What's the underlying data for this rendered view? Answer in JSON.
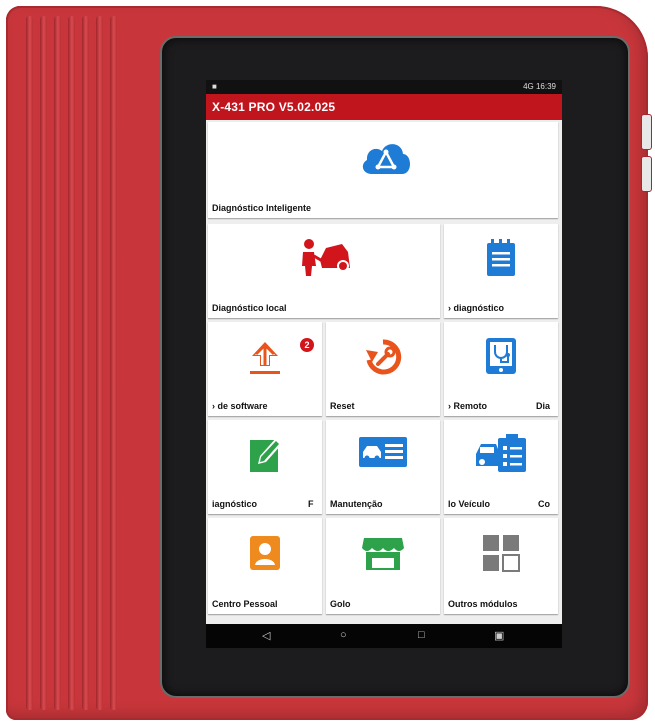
{
  "status_bar": {
    "left_icon": "notification-icon",
    "right_text": "4G 16:39"
  },
  "app_bar": {
    "title": "X-431 PRO V5.02.025"
  },
  "tiles": {
    "smart_diag": {
      "label": "Diagnóstico Inteligente",
      "icon": "cloud-diagnostics-icon",
      "color": "#1e7bd6"
    },
    "local_diag": {
      "label": "Diagnóstico local",
      "icon": "mechanic-car-icon",
      "color": "#d2141b"
    },
    "diag_report": {
      "label": "› diagnóstico",
      "icon": "report-notepad-icon",
      "color": "#1e7bd6"
    },
    "software_update": {
      "label": "› de software",
      "icon": "upload-arrow-icon",
      "color": "#e8541c",
      "badge": "2"
    },
    "reset": {
      "label": "Reset",
      "icon": "wrench-reset-icon",
      "color": "#e8541c"
    },
    "remote": {
      "label": "› Remoto",
      "label_right": "Dia",
      "icon": "remote-stethoscope-icon",
      "color": "#1e7bd6"
    },
    "feedback": {
      "label": "iagnóstico",
      "label_right": "F",
      "icon": "edit-pencil-icon",
      "color": "#2ea24a"
    },
    "maintenance": {
      "label": "Manutenção",
      "icon": "car-list-icon",
      "color": "#1e7bd6"
    },
    "vehicle": {
      "label": "lo Veículo",
      "label_right": "Co",
      "icon": "car-clipboard-icon",
      "color": "#1e7bd6"
    },
    "personal": {
      "label": "Centro Pessoal",
      "icon": "person-icon",
      "color": "#ef8a1e"
    },
    "store": {
      "label": "Golo",
      "icon": "store-icon",
      "color": "#2ea24a"
    },
    "other": {
      "label": "Outros módulos",
      "icon": "modules-grid-icon",
      "color": "#7a7a7a"
    }
  },
  "nav_bar": {
    "back": "◁",
    "home": "○",
    "recent": "□",
    "extra": "▣"
  }
}
